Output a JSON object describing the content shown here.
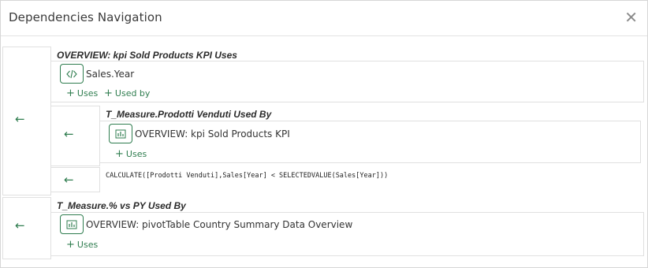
{
  "dialog": {
    "title": "Dependencies Navigation",
    "close_glyph": "✕"
  },
  "arrow_glyph": "←",
  "plus_glyph": "+",
  "sections": [
    {
      "heading": "OVERVIEW: kpi Sold Products KPI Uses",
      "item": {
        "icon": "code-icon",
        "label": "Sales.Year",
        "uses": "Uses",
        "used_by": "Used by"
      },
      "nested": {
        "heading": "T_Measure.Prodotti Venduti Used By",
        "item": {
          "icon": "chart-icon",
          "label": "OVERVIEW: kpi Sold Products KPI",
          "uses": "Uses"
        }
      },
      "code": "CALCULATE([Prodotti Venduti],Sales[Year] < SELECTEDVALUE(Sales[Year]))"
    },
    {
      "heading": "T_Measure.% vs PY Used By",
      "item": {
        "icon": "chart-icon",
        "label": "OVERVIEW: pivotTable Country Summary Data Overview",
        "uses": "Uses"
      }
    }
  ],
  "colors": {
    "accent": "#2f7d4f",
    "border": "#e0e0e0",
    "text": "#333333"
  }
}
